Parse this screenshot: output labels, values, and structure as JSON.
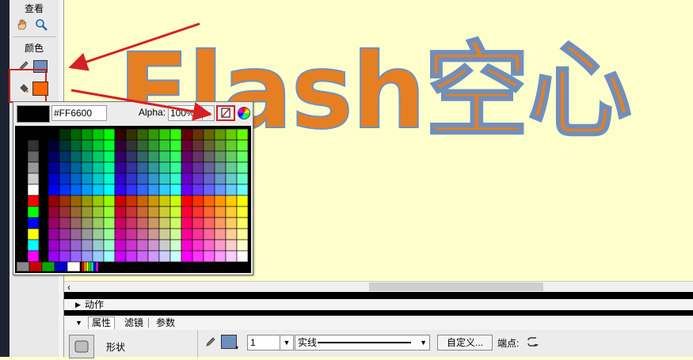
{
  "tools": {
    "view_label": "查看",
    "color_label": "颜色"
  },
  "stage": {
    "text": "Flash空心"
  },
  "color_popup": {
    "hex_value": "#FF6600",
    "alpha_label": "Alpha:",
    "alpha_value": "100%"
  },
  "panels": {
    "actions_label": "动作",
    "tab_properties": "属性",
    "tab_filters": "滤镜",
    "tab_params": "参数"
  },
  "properties": {
    "shape_label": "形状",
    "stroke_height": "1",
    "stroke_style": "实线",
    "custom_button": "自定义...",
    "cap_label": "端点:"
  },
  "colors": {
    "fill": "#ff6600",
    "stroke": "#6e8fbf",
    "stage_bg": "#ffffcc",
    "highlight": "#d42020"
  }
}
